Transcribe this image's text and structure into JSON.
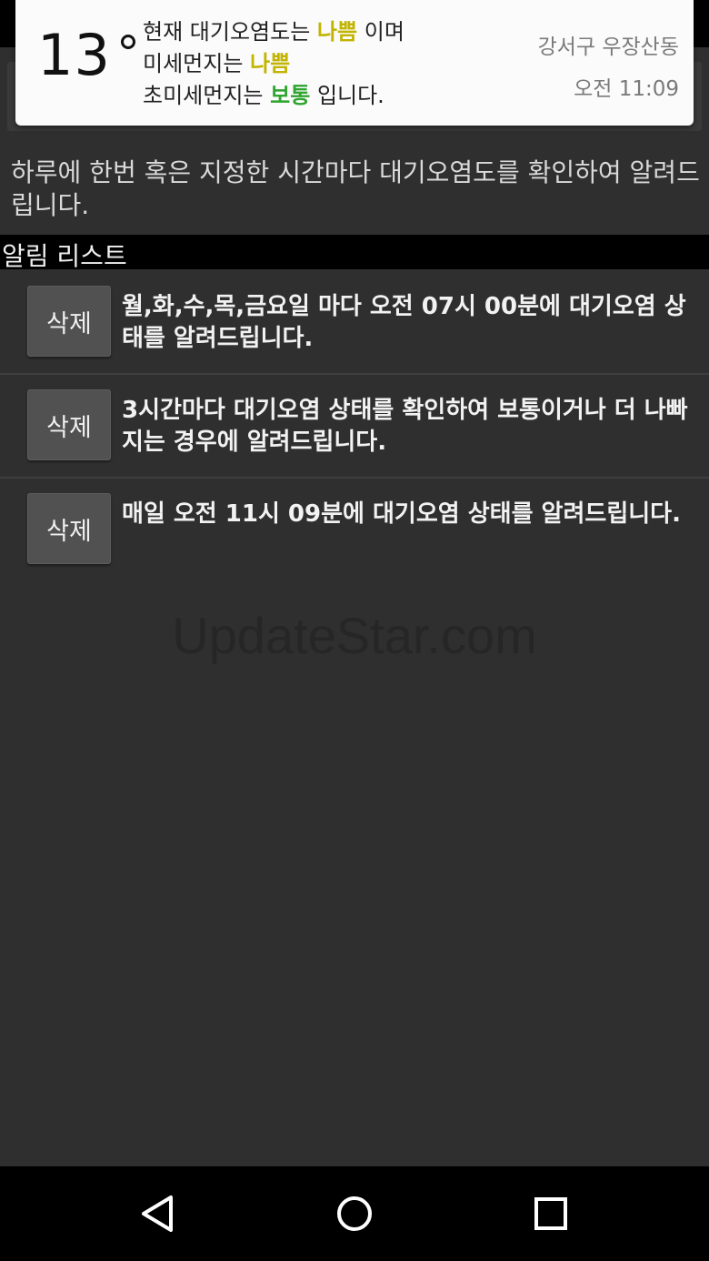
{
  "notification": {
    "temperature": "13",
    "line1_prefix": "현재 대기오염도는",
    "line1_level": "나쁨",
    "line1_suffix": "이며",
    "line2_prefix": "미세먼지는",
    "line2_level": "나쁨",
    "line3_prefix": "초미세먼지는",
    "line3_level": "보통",
    "line3_suffix": "입니다.",
    "location": "강서구 우장산동",
    "time": "오전 11:09",
    "colors": {
      "bad": "#c2b400",
      "normal": "#2fa52f"
    }
  },
  "description": "하루에 한번 혹은 지정한 시간마다 대기오염도를 확인하여 알려드립니다.",
  "alarm_list": {
    "header": "알림 리스트",
    "items": [
      {
        "delete_label": "삭제",
        "text": "월,화,수,목,금요일 마다 오전 07시 00분에 대기오염 상태를 알려드립니다."
      },
      {
        "delete_label": "삭제",
        "text": "3시간마다 대기오염 상태를 확인하여 보통이거나 더 나빠지는 경우에 알려드립니다."
      },
      {
        "delete_label": "삭제",
        "text": "매일 오전 11시 09분에 대기오염 상태를 알려드립니다."
      }
    ]
  },
  "watermark": "UpdateStar.com",
  "nav": {
    "icons": [
      "back-icon",
      "home-icon",
      "recents-icon"
    ]
  }
}
